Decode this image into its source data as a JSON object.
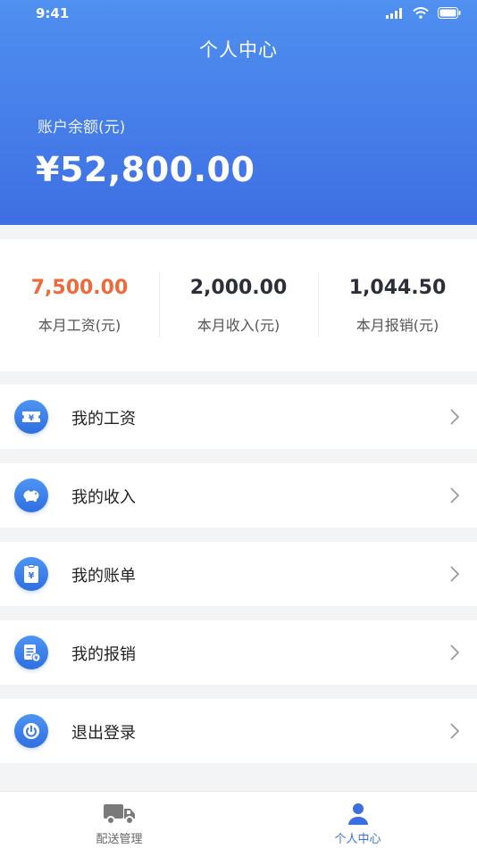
{
  "status_bar": {
    "time": "9:41"
  },
  "header": {
    "title": "个人中心",
    "balance_label": "账户余额(元)",
    "balance_value": "¥52,800.00"
  },
  "stats": [
    {
      "value": "7,500.00",
      "label": "本月工资(元)",
      "color": "#ef6a3a"
    },
    {
      "value": "2,000.00",
      "label": "本月收入(元)"
    },
    {
      "value": "1,044.50",
      "label": "本月报销(元)"
    }
  ],
  "menu": [
    {
      "label": "我的工资",
      "icon": "ticket-icon"
    },
    {
      "label": "我的收入",
      "icon": "piggy-bank-icon"
    },
    {
      "label": "我的账单",
      "icon": "bill-icon"
    },
    {
      "label": "我的报销",
      "icon": "reimbursement-icon"
    },
    {
      "label": "退出登录",
      "icon": "power-icon"
    }
  ],
  "tabs": [
    {
      "label": "配送管理",
      "icon": "truck-icon",
      "active": false
    },
    {
      "label": "个人中心",
      "icon": "user-icon",
      "active": true
    }
  ],
  "colors": {
    "brand": "#3e6fe3",
    "accent": "#ef6a3a"
  }
}
